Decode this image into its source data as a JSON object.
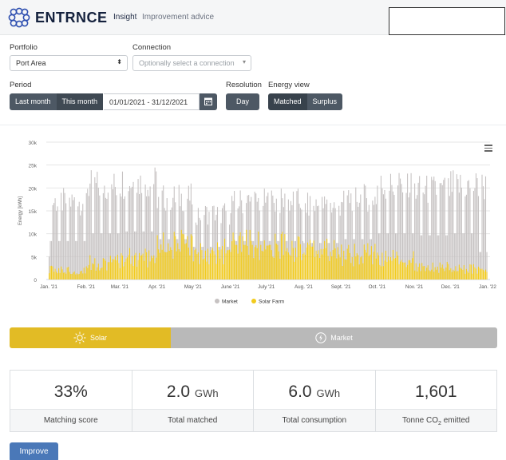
{
  "header": {
    "brand": "ENTRNCE",
    "nav": {
      "insight": "Insight",
      "advice": "Improvement advice"
    }
  },
  "filters": {
    "portfolio_label": "Portfolio",
    "portfolio_value": "Port Area",
    "connection_label": "Connection",
    "connection_placeholder": "Optionally select a connection",
    "period_label": "Period",
    "last_month": "Last month",
    "this_month": "This month",
    "date_range": "01/01/2021 - 31/12/2021",
    "resolution_label": "Resolution",
    "resolution_value": "Day",
    "energy_view_label": "Energy view",
    "matched": "Matched",
    "surplus": "Surplus"
  },
  "chart_data": {
    "type": "bar",
    "stacked": true,
    "ylabel": "Energy [kWh]",
    "ylim": [
      0,
      30000
    ],
    "yticks": [
      "0",
      "5k",
      "10k",
      "15k",
      "20k",
      "25k",
      "30k"
    ],
    "x_tick_labels": [
      "Jan. '21",
      "Feb. '21",
      "Mar. '21",
      "Apr. '21",
      "May '21",
      "June '21",
      "July '21",
      "Aug. '21",
      "Sept. '21",
      "Oct. '21",
      "Nov. '21",
      "Dec. '21",
      "Jan. '22"
    ],
    "resolution": "daily",
    "x_range": [
      "2021-01-01",
      "2021-12-31"
    ],
    "monthly_total_peak_kwh": [
      20000,
      24000,
      25000,
      21000,
      17000,
      20000,
      20000,
      19000,
      21000,
      24000,
      23000,
      24000
    ],
    "monthly_solar_peak_kwh": [
      3000,
      5500,
      7000,
      11000,
      9000,
      11000,
      10500,
      9500,
      8000,
      6500,
      4000,
      3500
    ],
    "series": [
      {
        "name": "Market",
        "color": "#c6c2c2"
      },
      {
        "name": "Solar Farm",
        "color": "#f2cb1d"
      }
    ],
    "legend_position": "bottom"
  },
  "energy_tabs": {
    "solar": "Solar",
    "market": "Market"
  },
  "stats": [
    {
      "value": "33%",
      "unit": "",
      "label": "Matching score"
    },
    {
      "value": "2.0",
      "unit": "GWh",
      "label": "Total matched"
    },
    {
      "value": "6.0",
      "unit": "GWh",
      "label": "Total consumption"
    },
    {
      "value": "1,601",
      "unit": "",
      "label_pre": "Tonne CO",
      "label_sub": "2",
      "label_post": " emitted"
    }
  ],
  "improve_label": "Improve",
  "colors": {
    "solar": "#e2bb25",
    "market_tab": "#b9b9b9",
    "button": "#4d5864",
    "improve": "#4a78b8"
  }
}
